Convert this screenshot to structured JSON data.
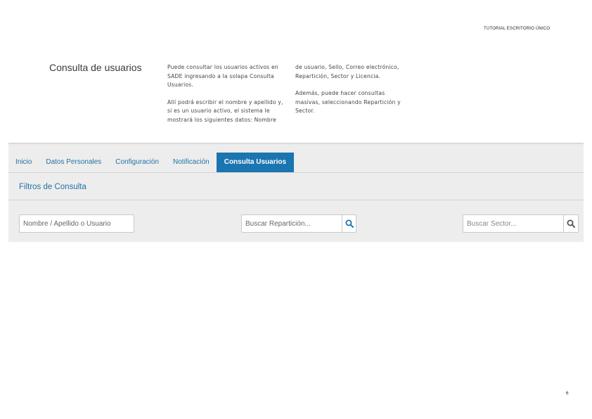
{
  "header": {
    "tag": "TUTORIAL ESCRITORIO ÚNICO"
  },
  "section": {
    "title": "Consulta de usuarios"
  },
  "description": {
    "col1_p1": "Puede consultar los usuarios activos en SADE ingresando a la solapa Consulta Usuarios.",
    "col1_p2": "Allí podrá escribir el nombre y apellido y, si es un usuario activo, el sistema le mostrará los siguientes datos: Nombre",
    "col2_p1": "de usuario, Sello, Correo electrónico, Repartición, Sector y Licencia.",
    "col2_p2": "Además, puede hacer consultas masivas, seleccionando Repartición y Sector."
  },
  "tabs": [
    {
      "label": "Inicio",
      "active": false
    },
    {
      "label": "Datos Personales",
      "active": false
    },
    {
      "label": "Configuración",
      "active": false
    },
    {
      "label": "Notificación",
      "active": false
    },
    {
      "label": "Consulta Usuarios",
      "active": true
    }
  ],
  "filters": {
    "title": "Filtros de Consulta",
    "name_placeholder": "Nombre / Apellido o Usuario",
    "reparticion_placeholder": "Buscar Repartición...",
    "sector_placeholder": "Buscar Sector..."
  },
  "icons": {
    "search": "search-icon"
  },
  "colors": {
    "accent": "#1b75b0",
    "link": "#2272a8",
    "panel_bg": "#ededed"
  },
  "footer": {
    "page_number": "6"
  }
}
